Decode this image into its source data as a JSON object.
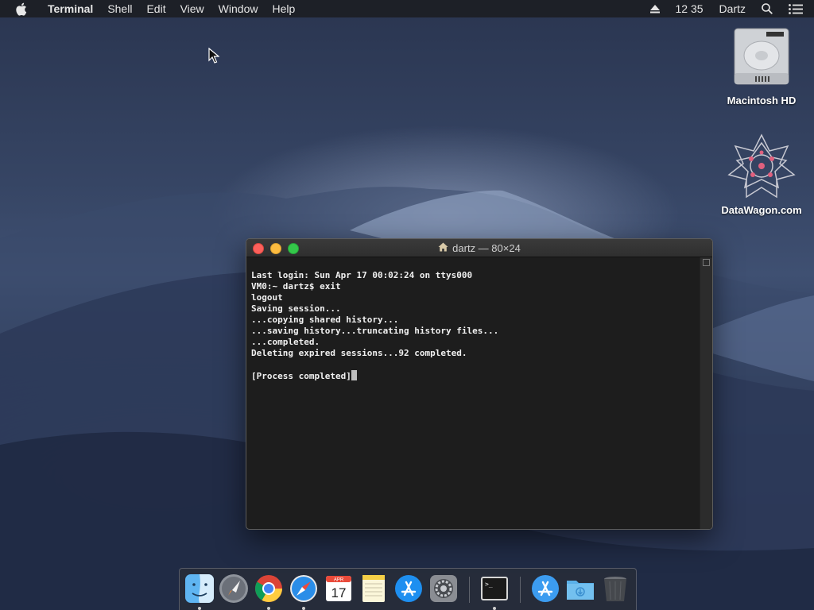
{
  "menubar": {
    "app_name": "Terminal",
    "items": [
      "Shell",
      "Edit",
      "View",
      "Window",
      "Help"
    ],
    "clock": "12 35",
    "user": "Dartz"
  },
  "desktop": {
    "icons": [
      {
        "label": "Macintosh HD",
        "icon": "hard-drive-icon"
      },
      {
        "label": "DataWagon.com",
        "icon": "datawagon-logo-icon"
      }
    ]
  },
  "terminal": {
    "title": "dartz — 80×24",
    "lines": [
      "Last login: Sun Apr 17 00:02:24 on ttys000",
      "VM0:~ dartz$ exit",
      "logout",
      "Saving session...",
      "...copying shared history...",
      "...saving history...truncating history files...",
      "...completed.",
      "Deleting expired sessions...92 completed.",
      "",
      "[Process completed]"
    ]
  },
  "dock": {
    "items": [
      {
        "name": "Finder",
        "icon": "finder-icon",
        "running": true
      },
      {
        "name": "Launchpad",
        "icon": "launchpad-icon",
        "running": false
      },
      {
        "name": "Google Chrome",
        "icon": "chrome-icon",
        "running": true
      },
      {
        "name": "Safari",
        "icon": "safari-icon",
        "running": true
      },
      {
        "name": "Calendar",
        "icon": "calendar-icon",
        "running": false,
        "month": "APR",
        "day": "17"
      },
      {
        "name": "Notes",
        "icon": "notes-icon",
        "running": false
      },
      {
        "name": "App Store",
        "icon": "app-store-icon",
        "running": false
      },
      {
        "name": "System Preferences",
        "icon": "system-preferences-icon",
        "running": false
      },
      {
        "name": "Terminal",
        "icon": "terminal-icon",
        "running": true
      },
      {
        "name": "Applications",
        "icon": "applications-folder-icon",
        "running": false
      },
      {
        "name": "Downloads",
        "icon": "downloads-folder-icon",
        "running": false
      },
      {
        "name": "Trash",
        "icon": "trash-icon",
        "running": false
      }
    ]
  }
}
